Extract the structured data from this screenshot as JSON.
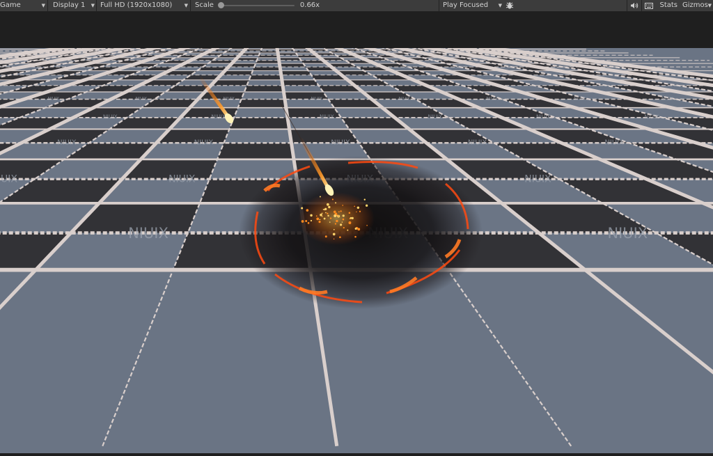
{
  "toolbar": {
    "view_label": "Game",
    "display_label": "Display 1",
    "resolution_label": "Full HD (1920x1080)",
    "scale_label": "Scale",
    "scale_value": "0.66x",
    "scale_fraction": 0.0,
    "play_mode_label": "Play Focused",
    "stats_label": "Stats",
    "gizmos_label": "Gizmos"
  },
  "icons": {
    "bug": "bug-icon",
    "audio": "speaker-icon",
    "grid": "keyboard-icon"
  },
  "scene": {
    "floor_watermark": "NIUIX",
    "tile_light": "#6b7585",
    "tile_dark": "#323236",
    "grid_line": "#d9cfcc",
    "fire_color": "#ff7a1a",
    "glow_color": "#ffc34a"
  }
}
